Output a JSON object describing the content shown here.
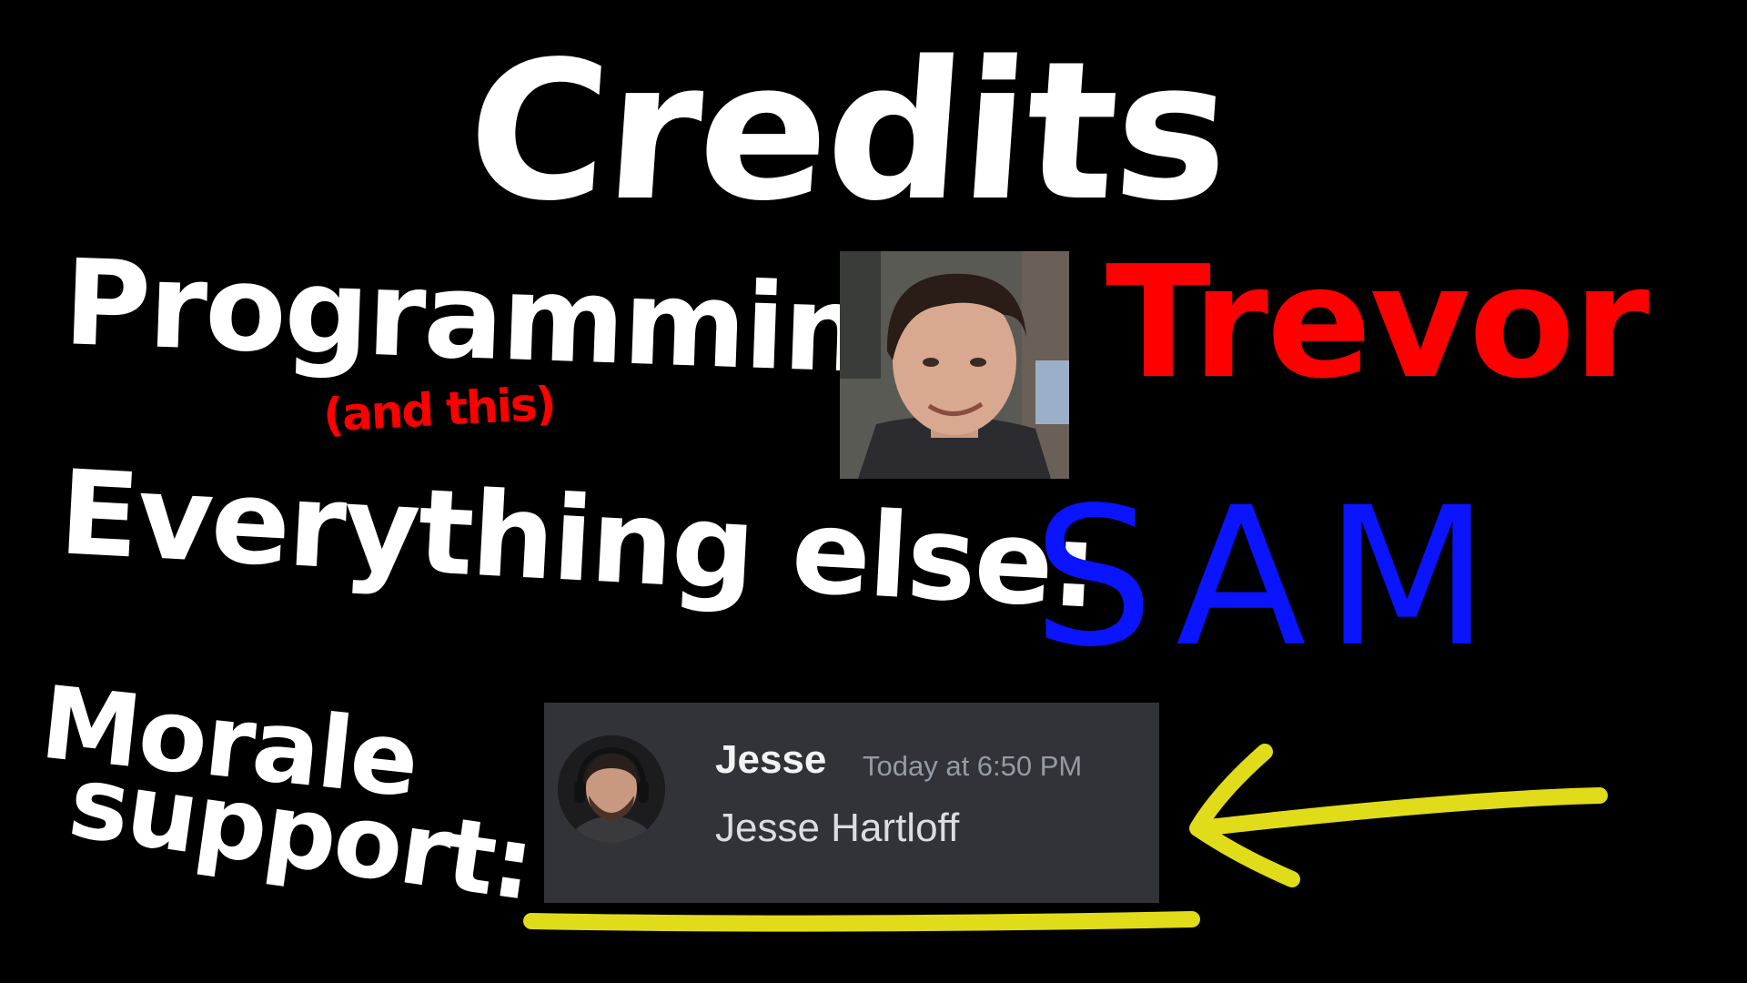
{
  "slide": {
    "title": "Credits",
    "programming_label": "Programming:",
    "programming_note": "(and this)",
    "programming_name": "Trevor",
    "everything_label": "Everything else:",
    "everything_name": "SAM",
    "morale_label_line1": "Morale",
    "morale_label_line2": "support:"
  },
  "chat": {
    "username": "Jesse",
    "timestamp": "Today at 6:50 PM",
    "message": "Jesse Hartloff",
    "avatar_icon": "person-headset-avatar-icon"
  },
  "icons": {
    "arrow": "arrow-left-icon",
    "underline": "underline-stroke-icon"
  },
  "colors": {
    "background": "#000000",
    "white_text": "#ffffff",
    "red_text": "#ff0000",
    "blue_text": "#0a14ff",
    "highlight_yellow": "#e0dc1a",
    "chat_background": "#313338"
  }
}
